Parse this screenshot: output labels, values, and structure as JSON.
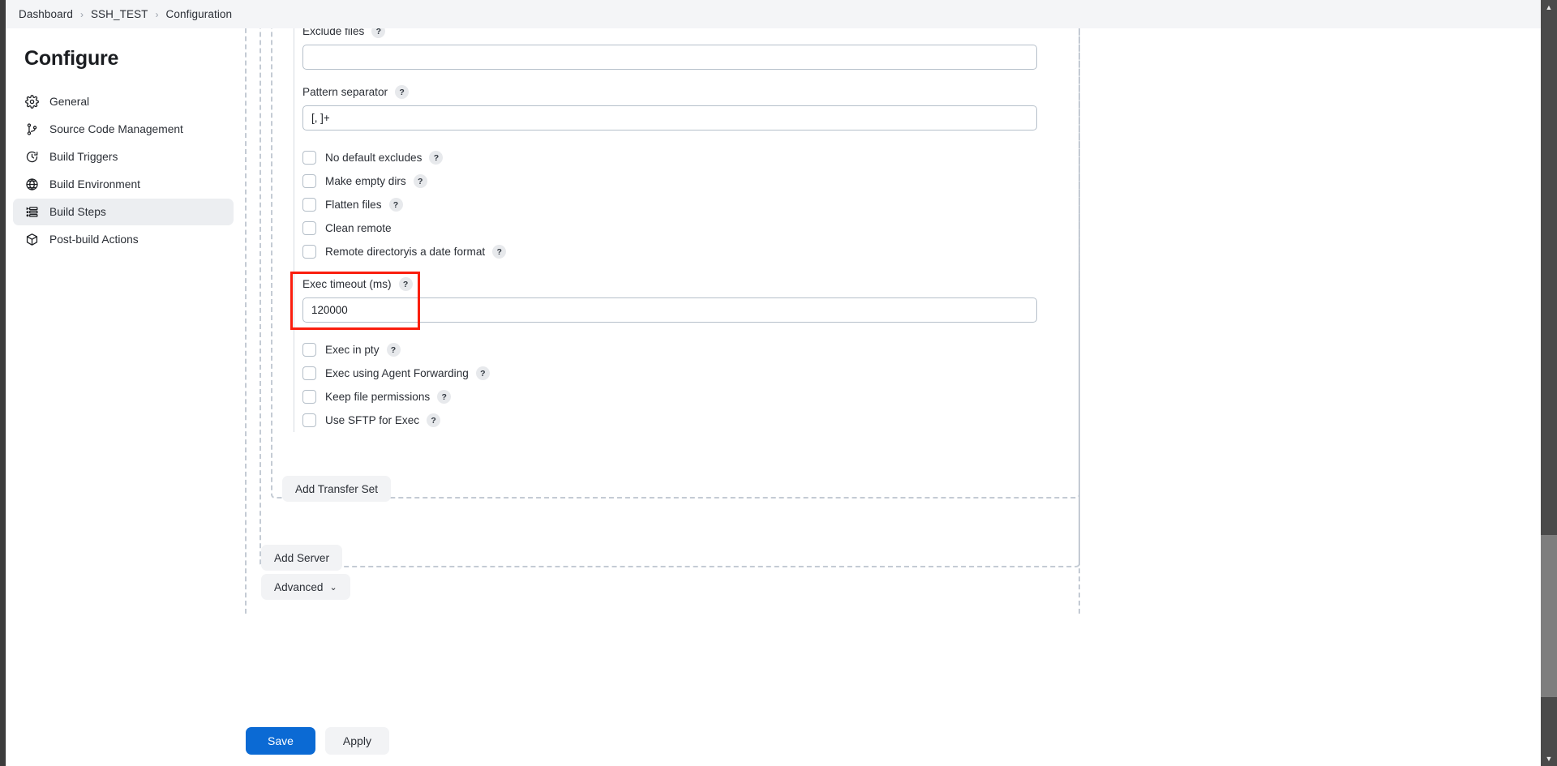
{
  "breadcrumb": {
    "items": [
      "Dashboard",
      "SSH_TEST",
      "Configuration"
    ],
    "separator": "›"
  },
  "sidebar": {
    "title": "Configure",
    "items": [
      {
        "label": "General",
        "icon": "gear-icon",
        "active": false
      },
      {
        "label": "Source Code Management",
        "icon": "git-branch-icon",
        "active": false
      },
      {
        "label": "Build Triggers",
        "icon": "clock-arrow-icon",
        "active": false
      },
      {
        "label": "Build Environment",
        "icon": "globe-icon",
        "active": false
      },
      {
        "label": "Build Steps",
        "icon": "list-icon",
        "active": true
      },
      {
        "label": "Post-build Actions",
        "icon": "package-icon",
        "active": false
      }
    ]
  },
  "form": {
    "exclude_files": {
      "label": "Exclude files",
      "help": "?",
      "value": ""
    },
    "pattern_separator": {
      "label": "Pattern separator",
      "help": "?",
      "value": "[, ]+"
    },
    "checkboxes_upper": [
      {
        "label": "No default excludes",
        "help": "?",
        "checked": false
      },
      {
        "label": "Make empty dirs",
        "help": "?",
        "checked": false
      },
      {
        "label": "Flatten files",
        "help": "?",
        "checked": false
      },
      {
        "label": "Clean remote",
        "help": "",
        "checked": false
      },
      {
        "label": "Remote directoryis a date format",
        "help": "?",
        "checked": false
      }
    ],
    "exec_timeout": {
      "label": "Exec timeout (ms)",
      "help": "?",
      "value": "120000"
    },
    "checkboxes_lower": [
      {
        "label": "Exec in pty",
        "help": "?",
        "checked": false
      },
      {
        "label": "Exec using Agent Forwarding",
        "help": "?",
        "checked": false
      },
      {
        "label": "Keep file permissions",
        "help": "?",
        "checked": false
      },
      {
        "label": "Use SFTP for Exec",
        "help": "?",
        "checked": false
      }
    ]
  },
  "buttons": {
    "add_transfer_set": "Add Transfer Set",
    "add_server": "Add Server",
    "advanced": "Advanced",
    "advanced_chevron": "⌄",
    "save": "Save",
    "apply": "Apply"
  },
  "scrollbar": {
    "up_arrow": "▲",
    "down_arrow": "▼"
  },
  "colors": {
    "accent": "#0b6ad4",
    "highlight_box": "#fa1e0e",
    "sidebar_active_bg": "#eceef1",
    "breadcrumb_bg": "#f4f5f7"
  }
}
